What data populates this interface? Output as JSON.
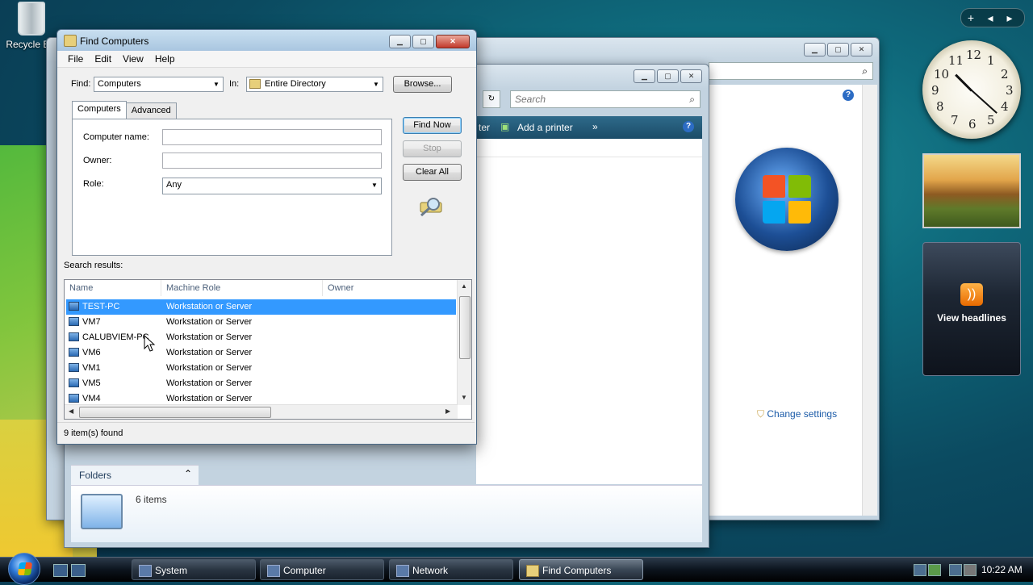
{
  "desktop": {
    "recycle_bin_label": "Recycle Bin"
  },
  "gadgets": {
    "clock_numbers": [
      "12",
      "1",
      "2",
      "3",
      "4",
      "5",
      "6",
      "7",
      "8",
      "9",
      "10",
      "11"
    ],
    "clock_time": "10:22",
    "rss_label": "View headlines"
  },
  "background_windows": {
    "search_placeholder": "Search",
    "toolbar_partial": "ter",
    "add_printer": "Add a printer",
    "change_settings": "Change settings",
    "folders_label": "Folders",
    "items_count": "6 items"
  },
  "dialog": {
    "title": "Find Computers",
    "menu": [
      "File",
      "Edit",
      "View",
      "Help"
    ],
    "find_label": "Find:",
    "find_value": "Computers",
    "in_label": "In:",
    "in_value": "Entire Directory",
    "browse_button": "Browse...",
    "tabs": [
      "Computers",
      "Advanced"
    ],
    "computer_name_label": "Computer name:",
    "owner_label": "Owner:",
    "role_label": "Role:",
    "role_value": "Any",
    "find_now_button": "Find Now",
    "stop_button": "Stop",
    "clear_all_button": "Clear All",
    "search_results_label": "Search results:",
    "columns": [
      "Name",
      "Machine Role",
      "Owner"
    ],
    "rows": [
      {
        "name": "TEST-PC",
        "role": "Workstation or Server",
        "owner": "",
        "selected": true
      },
      {
        "name": "VM7",
        "role": "Workstation or Server",
        "owner": "",
        "selected": false
      },
      {
        "name": "CALUBVIEM-PC",
        "role": "Workstation or Server",
        "owner": "",
        "selected": false
      },
      {
        "name": "VM6",
        "role": "Workstation or Server",
        "owner": "",
        "selected": false
      },
      {
        "name": "VM1",
        "role": "Workstation or Server",
        "owner": "",
        "selected": false
      },
      {
        "name": "VM5",
        "role": "Workstation or Server",
        "owner": "",
        "selected": false
      },
      {
        "name": "VM4",
        "role": "Workstation or Server",
        "owner": "",
        "selected": false
      }
    ],
    "status": "9 item(s) found"
  },
  "taskbar": {
    "tasks": [
      "System",
      "Computer",
      "Network",
      "Find Computers"
    ],
    "active_task": "Find Computers",
    "clock": "10:22 AM"
  },
  "colors": {
    "selection": "#3399ff",
    "taskbar": "#0c141d",
    "dialog_title": "#a9c6e0"
  }
}
